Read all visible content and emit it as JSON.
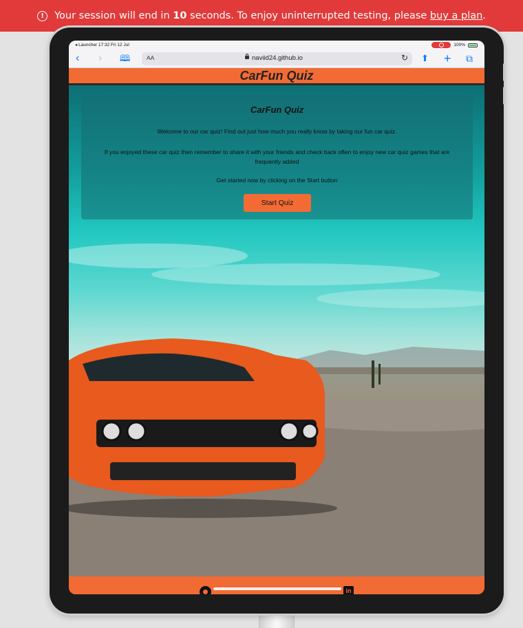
{
  "banner": {
    "prefix": "Your session will end in",
    "seconds": "10",
    "middle": "seconds. To enjoy uninterrupted testing, please",
    "link": "buy a plan",
    "suffix": "."
  },
  "statusbar": {
    "left": "◂ Launcher  17:32  Fri 12 Jul",
    "battery": "100%"
  },
  "browser": {
    "text_size_label": "AA",
    "url": "naviid24.github.io",
    "icons": [
      "back-icon",
      "forward-icon",
      "bookmarks-icon",
      "reload-icon",
      "share-icon",
      "new-tab-icon",
      "tabs-icon"
    ]
  },
  "header": {
    "title": "CarFun Quiz"
  },
  "quiz": {
    "title": "CarFun Quiz",
    "intro": "Welcome to our car quiz! Find out just how much you really know by taking our fun car quiz.",
    "share_text": "If you enjoyed these car quiz then remember to share it with your friends and check back often to enjoy new car quiz games that are frequently added",
    "cta_text": "Get started now by clicking on the Start button",
    "start_label": "Start Quiz"
  },
  "footer": {
    "icons": [
      "github-icon",
      "linkedin-icon"
    ]
  },
  "colors": {
    "banner": "#e23a3a",
    "brand_orange": "#f26b35",
    "ipad_frame": "#1b1b1b"
  }
}
